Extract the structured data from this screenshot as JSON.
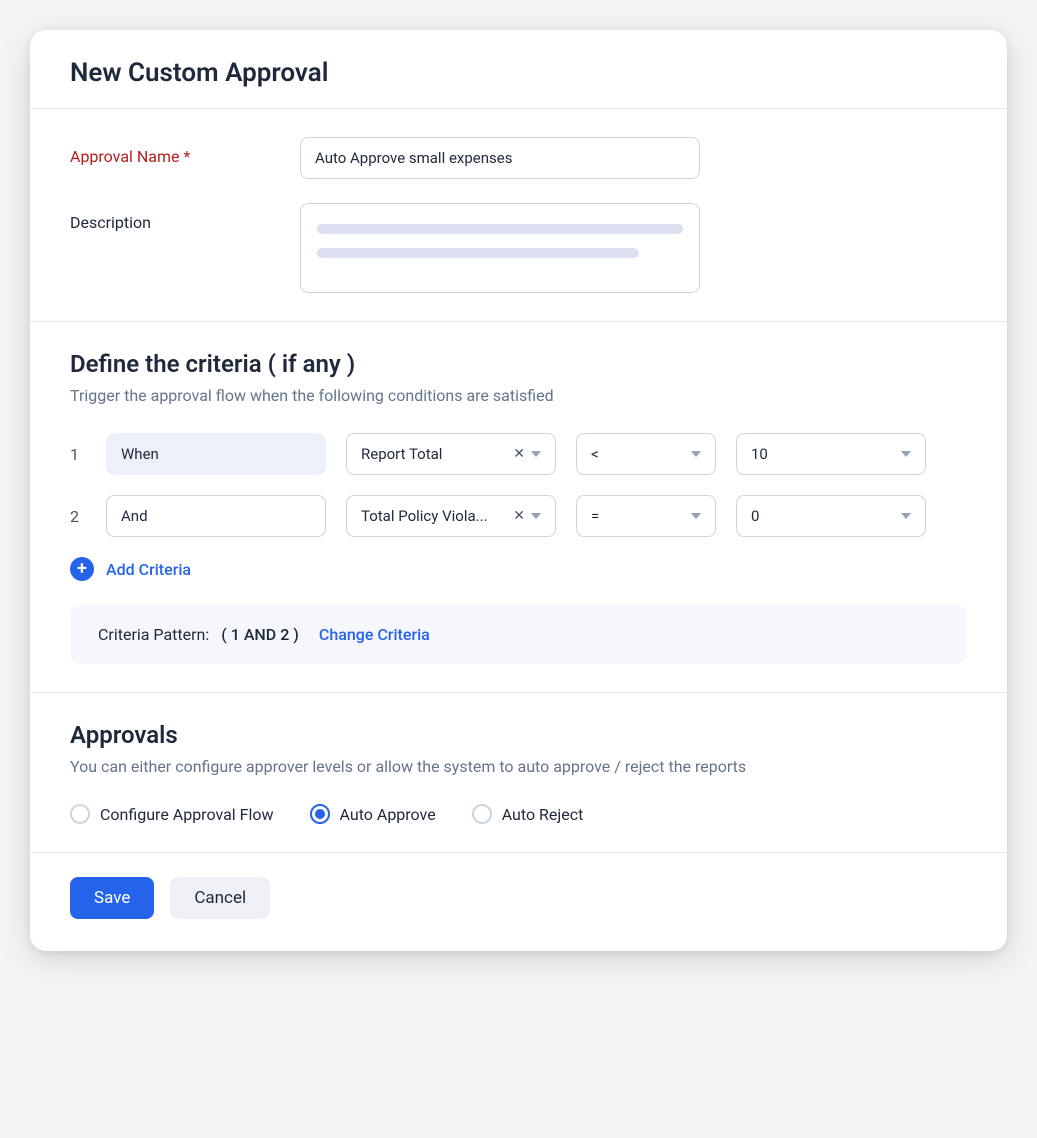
{
  "header": {
    "title": "New Custom Approval"
  },
  "form": {
    "approval_name_label": "Approval Name *",
    "approval_name_value": "Auto Approve small expenses",
    "description_label": "Description"
  },
  "criteria_section": {
    "title": "Define the criteria ( if any )",
    "subtitle": "Trigger the approval flow when the following conditions are satisfied",
    "rows": [
      {
        "num": "1",
        "connector": "When",
        "connector_readonly": true,
        "field": "Report Total",
        "operator": "<",
        "value": "10"
      },
      {
        "num": "2",
        "connector": "And",
        "connector_readonly": false,
        "field": "Total Policy Viola...",
        "operator": "=",
        "value": "0"
      }
    ],
    "add_label": "Add Criteria",
    "pattern_label": "Criteria Pattern:",
    "pattern_value": "( 1 AND 2 )",
    "change_label": "Change Criteria"
  },
  "approvals_section": {
    "title": "Approvals",
    "subtitle": "You can either configure approver levels  or allow the system to auto approve / reject the reports",
    "options": [
      {
        "label": "Configure Approval Flow",
        "checked": false
      },
      {
        "label": "Auto Approve",
        "checked": true
      },
      {
        "label": "Auto Reject",
        "checked": false
      }
    ]
  },
  "footer": {
    "save": "Save",
    "cancel": "Cancel"
  }
}
